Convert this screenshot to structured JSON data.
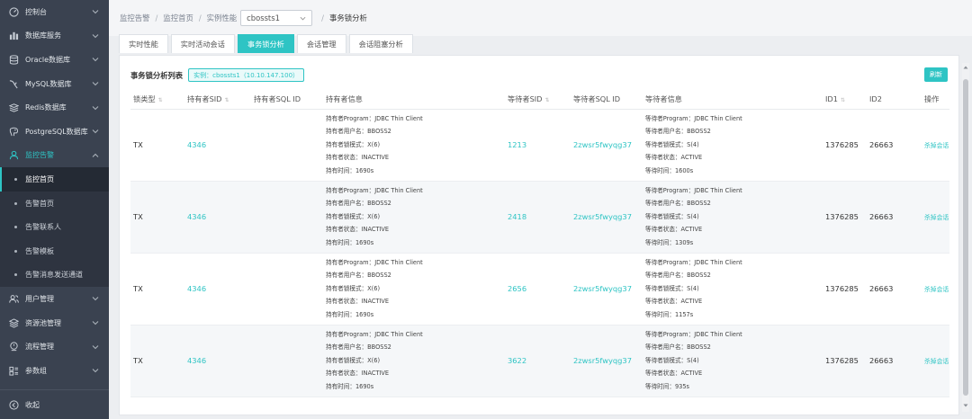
{
  "sidebar": {
    "items": [
      {
        "label": "控制台",
        "icon": "dashboard-icon"
      },
      {
        "label": "数据库服务",
        "icon": "database-service-icon"
      },
      {
        "label": "Oracle数据库",
        "icon": "oracle-db-icon"
      },
      {
        "label": "MySQL数据库",
        "icon": "mysql-db-icon"
      },
      {
        "label": "Redis数据库",
        "icon": "redis-db-icon"
      },
      {
        "label": "PostgreSQL数据库",
        "icon": "postgresql-db-icon"
      },
      {
        "label": "监控告警",
        "icon": "monitor-alert-icon"
      }
    ],
    "sub_items": [
      "监控首页",
      "告警首页",
      "告警联系人",
      "告警模板",
      "告警消息发送通道"
    ],
    "bottom_items": [
      {
        "label": "用户管理",
        "icon": "user-icon"
      },
      {
        "label": "资源池管理",
        "icon": "resource-pool-icon"
      },
      {
        "label": "流程管理",
        "icon": "workflow-icon"
      },
      {
        "label": "参数组",
        "icon": "param-group-icon"
      }
    ],
    "collapse_label": "收起"
  },
  "breadcrumb": {
    "c1": "监控告警",
    "c2": "监控首页",
    "c3": "实例性能",
    "select_value": "cbossts1",
    "current": "事务锁分析"
  },
  "tabs": [
    "实时性能",
    "实时活动会话",
    "事务锁分析",
    "会话管理",
    "会话阻塞分析"
  ],
  "panel": {
    "title": "事务锁分析列表",
    "instance_tag": "实例：cbossts1（10.10.147.100）",
    "refresh_label": "刷新"
  },
  "table": {
    "headers": {
      "lock_type": "锁类型",
      "holder_sid": "持有者SID",
      "holder_sql_id": "持有者SQL ID",
      "holder_info": "持有者信息",
      "waiter_sid": "等待者SID",
      "waiter_sql_id": "等待者SQL ID",
      "waiter_info": "等待者信息",
      "id1": "ID1",
      "id2": "ID2",
      "action": "操作"
    },
    "rows": [
      {
        "lock_type": "TX",
        "holder_sid": "4346",
        "holder_sql_id": "",
        "holder_info": [
          "持有者Program：JDBC Thin Client",
          "持有者用户名：BBOSS2",
          "持有者锁模式：X(6)",
          "持有者状态：INACTIVE",
          "持有时间：1690s"
        ],
        "waiter_sid": "1213",
        "waiter_sql_id": "2zwsr5fwyqg37",
        "waiter_info": [
          "等待者Program：JDBC Thin Client",
          "等待者用户名：BBOSS2",
          "等待者锁模式：S(4)",
          "等待者状态：ACTIVE",
          "等待时间：1600s"
        ],
        "id1": "1376285",
        "id2": "26663",
        "action": "杀掉会话"
      },
      {
        "lock_type": "TX",
        "holder_sid": "4346",
        "holder_sql_id": "",
        "holder_info": [
          "持有者Program：JDBC Thin Client",
          "持有者用户名：BBOSS2",
          "持有者锁模式：X(6)",
          "持有者状态：INACTIVE",
          "持有时间：1690s"
        ],
        "waiter_sid": "2418",
        "waiter_sql_id": "2zwsr5fwyqg37",
        "waiter_info": [
          "等待者Program：JDBC Thin Client",
          "等待者用户名：BBOSS2",
          "等待者锁模式：S(4)",
          "等待者状态：ACTIVE",
          "等待时间：1309s"
        ],
        "id1": "1376285",
        "id2": "26663",
        "action": "杀掉会话"
      },
      {
        "lock_type": "TX",
        "holder_sid": "4346",
        "holder_sql_id": "",
        "holder_info": [
          "持有者Program：JDBC Thin Client",
          "持有者用户名：BBOSS2",
          "持有者锁模式：X(6)",
          "持有者状态：INACTIVE",
          "持有时间：1690s"
        ],
        "waiter_sid": "2656",
        "waiter_sql_id": "2zwsr5fwyqg37",
        "waiter_info": [
          "等待者Program：JDBC Thin Client",
          "等待者用户名：BBOSS2",
          "等待者锁模式：S(4)",
          "等待者状态：ACTIVE",
          "等待时间：1157s"
        ],
        "id1": "1376285",
        "id2": "26663",
        "action": "杀掉会话"
      },
      {
        "lock_type": "TX",
        "holder_sid": "4346",
        "holder_sql_id": "",
        "holder_info": [
          "持有者Program：JDBC Thin Client",
          "持有者用户名：BBOSS2",
          "持有者锁模式：X(6)",
          "持有者状态：INACTIVE",
          "持有时间：1690s"
        ],
        "waiter_sid": "3622",
        "waiter_sql_id": "2zwsr5fwyqg37",
        "waiter_info": [
          "等待者Program：JDBC Thin Client",
          "等待者用户名：BBOSS2",
          "等待者锁模式：S(4)",
          "等待者状态：ACTIVE",
          "等待时间：935s"
        ],
        "id1": "1376285",
        "id2": "26663",
        "action": "杀掉会话"
      }
    ]
  },
  "colors": {
    "accent": "#2ec4c4",
    "sidebar_bg": "#3a4250",
    "sidebar_sub_bg": "#2e3440"
  }
}
